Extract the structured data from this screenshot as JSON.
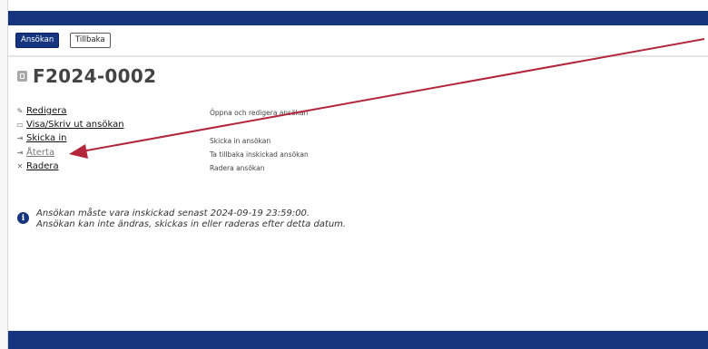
{
  "toolbar": {
    "primary_button": "Ansökan",
    "back_button": "Tillbaka"
  },
  "page": {
    "title": "F2024-0002"
  },
  "actions": [
    {
      "icon": "edit-icon",
      "glyph": "✎",
      "label": "Redigera",
      "description": "Öppna och redigera ansökan"
    },
    {
      "icon": "print-icon",
      "glyph": "▭",
      "label": "Visa/Skriv ut ansökan",
      "description": ""
    },
    {
      "icon": "send-icon",
      "glyph": "⇥",
      "label": "Skicka in",
      "description": "Skicka in ansökan"
    },
    {
      "icon": "withdraw-icon",
      "glyph": "⇥",
      "label": "Återta",
      "description": "Ta tillbaka inskickad ansökan"
    },
    {
      "icon": "delete-icon",
      "glyph": "✕",
      "label": "Radera",
      "description": "Radera ansökan"
    }
  ],
  "notice": {
    "line1": "Ansökan måste vara inskickad senast 2024-09-19 23:59:00.",
    "line2": "Ansökan kan inte ändras, skickas in eller raderas efter detta datum."
  },
  "colors": {
    "brand": "#17357f",
    "annotation_arrow": "#b3263b"
  }
}
